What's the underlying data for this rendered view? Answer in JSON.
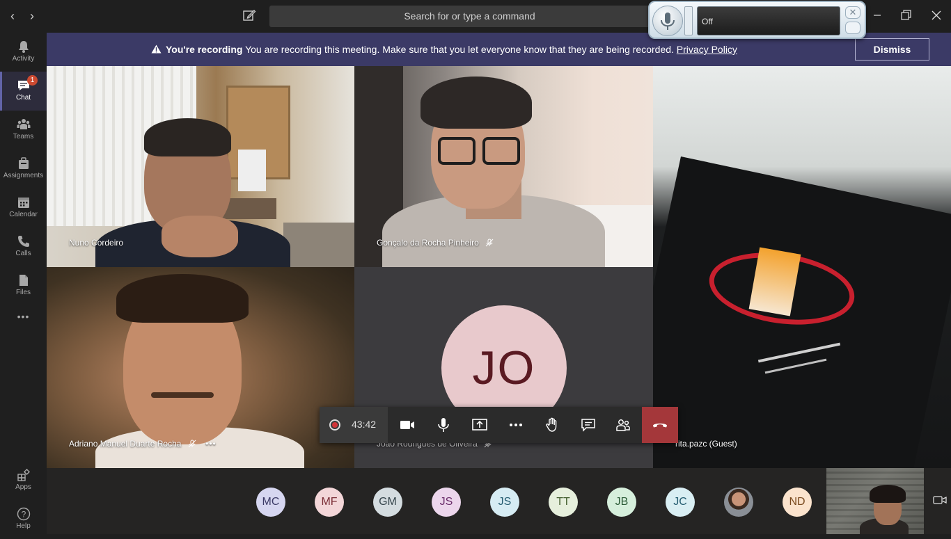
{
  "titlebar": {
    "back_icon": "chevron-left-icon",
    "forward_icon": "chevron-right-icon",
    "compose_icon": "compose-icon",
    "search_placeholder": "Search for or type a command"
  },
  "mic_widget": {
    "status": "Off"
  },
  "sidebar": {
    "items": [
      {
        "label": "Activity",
        "icon": "bell-icon"
      },
      {
        "label": "Chat",
        "icon": "chat-icon",
        "badge": "1",
        "active": true
      },
      {
        "label": "Teams",
        "icon": "teams-icon"
      },
      {
        "label": "Assignments",
        "icon": "assignments-icon"
      },
      {
        "label": "Calendar",
        "icon": "calendar-icon"
      },
      {
        "label": "Calls",
        "icon": "phone-icon"
      },
      {
        "label": "Files",
        "icon": "file-icon"
      }
    ],
    "more": "•••",
    "bottom": [
      {
        "label": "Apps",
        "icon": "apps-icon"
      },
      {
        "label": "Help",
        "icon": "help-icon"
      }
    ]
  },
  "banner": {
    "bold": "You're recording",
    "text": "You are recording this meeting. Make sure that you let everyone know that they are being recorded.",
    "link": "Privacy Policy",
    "dismiss": "Dismiss"
  },
  "tiles": [
    {
      "name": "Nuno Cordeiro",
      "muted": false
    },
    {
      "name": "Gonçalo da Rocha Pinheiro",
      "muted": true
    },
    {
      "name": "rita.pazc (Guest)",
      "muted": false
    },
    {
      "name": "Adriano Manuel Duarte Rocha",
      "muted": true,
      "more": "•••"
    },
    {
      "name": "João Rodrigues de Oliveira",
      "muted": true,
      "initials": "JO"
    }
  ],
  "controls": {
    "timer": "43:42"
  },
  "participants": [
    {
      "initials": "MC",
      "bg": "#d6d6f0",
      "fg": "#3b3a66"
    },
    {
      "initials": "MF",
      "bg": "#f3d6d8",
      "fg": "#7a2d35"
    },
    {
      "initials": "GM",
      "bg": "#d4dce0",
      "fg": "#33434a"
    },
    {
      "initials": "JS",
      "bg": "#ecd6ec",
      "fg": "#6a2c6a"
    },
    {
      "initials": "JS",
      "bg": "#d6ecf3",
      "fg": "#245c70"
    },
    {
      "initials": "TT",
      "bg": "#e6efdc",
      "fg": "#3f5a2a"
    },
    {
      "initials": "JB",
      "bg": "#d6efdc",
      "fg": "#2a5a36"
    },
    {
      "initials": "JC",
      "bg": "#d9eef3",
      "fg": "#245c70"
    },
    {
      "initials": "",
      "photo": true
    },
    {
      "initials": "ND",
      "bg": "#fbe3cd",
      "fg": "#7a4a1e"
    }
  ]
}
